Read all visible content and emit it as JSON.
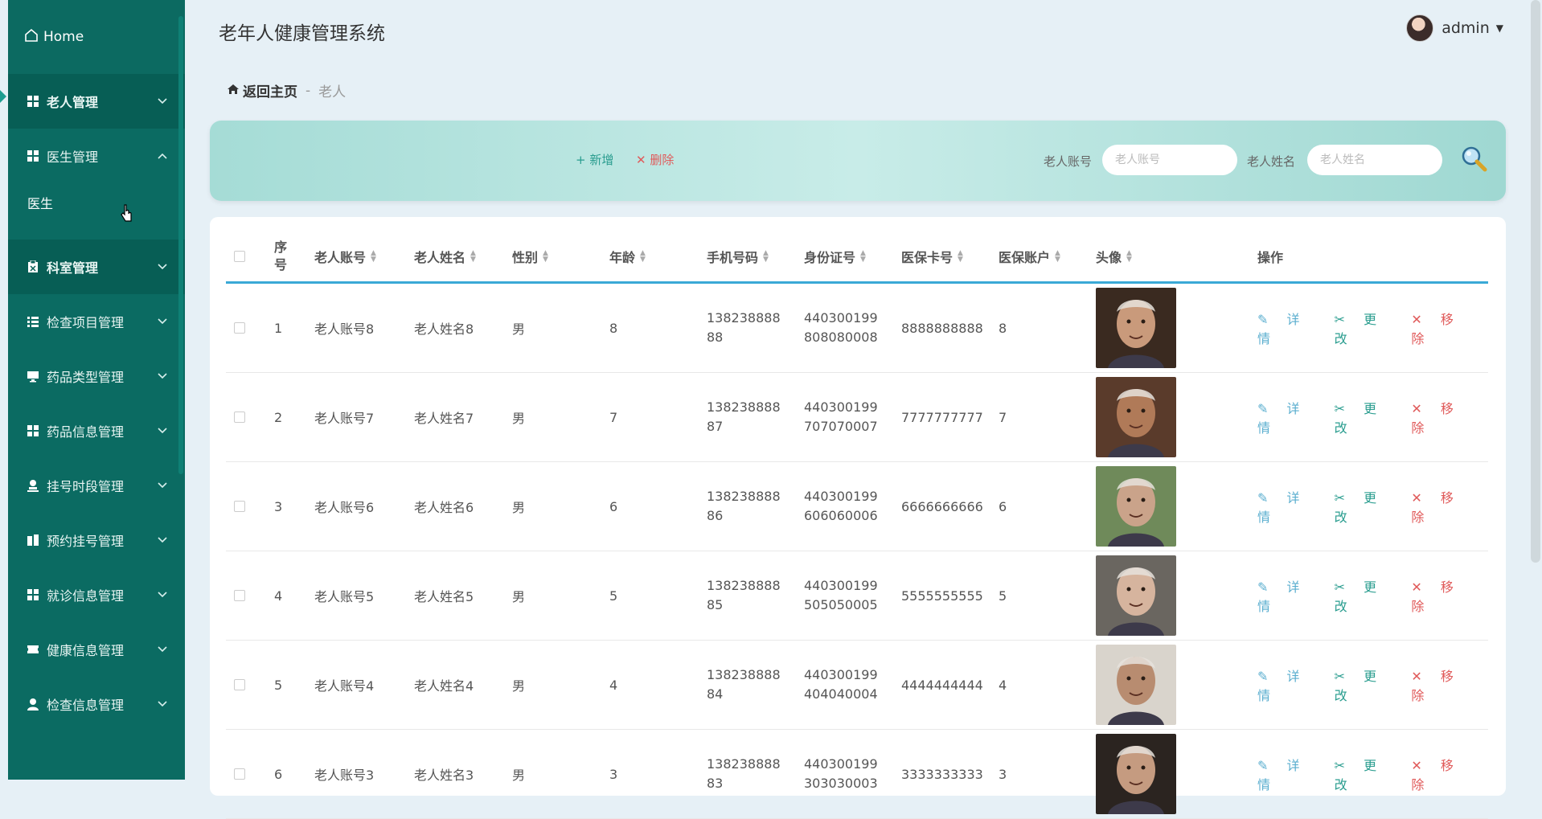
{
  "sidebar": {
    "home": "Home",
    "items": [
      {
        "label": "老人管理",
        "icon": "grid-icon",
        "state": "active"
      },
      {
        "label": "医生管理",
        "icon": "grid-icon",
        "state": "open",
        "children": [
          "医生"
        ]
      },
      {
        "label": "科室管理",
        "icon": "clipboard-icon",
        "state": "dark"
      },
      {
        "label": "检查项目管理",
        "icon": "list-icon",
        "state": ""
      },
      {
        "label": "药品类型管理",
        "icon": "monitor-icon",
        "state": ""
      },
      {
        "label": "药品信息管理",
        "icon": "grid-icon",
        "state": ""
      },
      {
        "label": "挂号时段管理",
        "icon": "user-stamp-icon",
        "state": ""
      },
      {
        "label": "预约挂号管理",
        "icon": "building-icon",
        "state": ""
      },
      {
        "label": "就诊信息管理",
        "icon": "grid-icon",
        "state": ""
      },
      {
        "label": "健康信息管理",
        "icon": "ticket-icon",
        "state": ""
      },
      {
        "label": "检查信息管理",
        "icon": "user-icon",
        "state": ""
      }
    ]
  },
  "header": {
    "title": "老年人健康管理系统",
    "user": "admin"
  },
  "breadcrumb": {
    "home": "返回主页",
    "separator": "-",
    "current": "老人"
  },
  "toolbar": {
    "add": "+ 新增",
    "delete": "✕ 删除",
    "account_label": "老人账号",
    "account_placeholder": "老人账号",
    "name_label": "老人姓名",
    "name_placeholder": "老人姓名"
  },
  "table": {
    "headers": {
      "index": "序号",
      "account": "老人账号",
      "name": "老人姓名",
      "gender": "性别",
      "age": "年龄",
      "phone": "手机号码",
      "id_card": "身份证号",
      "insurance_card": "医保卡号",
      "insurance_account": "医保账户",
      "avatar": "头像",
      "actions": "操作"
    },
    "actions": {
      "detail": "详情",
      "edit": "更改",
      "remove": "移除"
    },
    "rows": [
      {
        "index": "1",
        "account": "老人账号8",
        "name": "老人姓名8",
        "gender": "男",
        "age": "8",
        "phone": "13823888888",
        "id_card": "440300199808080008",
        "insurance_card": "8888888888",
        "insurance_account": "8"
      },
      {
        "index": "2",
        "account": "老人账号7",
        "name": "老人姓名7",
        "gender": "男",
        "age": "7",
        "phone": "13823888887",
        "id_card": "440300199707070007",
        "insurance_card": "7777777777",
        "insurance_account": "7"
      },
      {
        "index": "3",
        "account": "老人账号6",
        "name": "老人姓名6",
        "gender": "男",
        "age": "6",
        "phone": "13823888886",
        "id_card": "440300199606060006",
        "insurance_card": "6666666666",
        "insurance_account": "6"
      },
      {
        "index": "4",
        "account": "老人账号5",
        "name": "老人姓名5",
        "gender": "男",
        "age": "5",
        "phone": "13823888885",
        "id_card": "440300199505050005",
        "insurance_card": "5555555555",
        "insurance_account": "5"
      },
      {
        "index": "5",
        "account": "老人账号4",
        "name": "老人姓名4",
        "gender": "男",
        "age": "4",
        "phone": "13823888884",
        "id_card": "440300199404040004",
        "insurance_card": "4444444444",
        "insurance_account": "4"
      },
      {
        "index": "6",
        "account": "老人账号3",
        "name": "老人姓名3",
        "gender": "男",
        "age": "3",
        "phone": "13823888883",
        "id_card": "440300199303030003",
        "insurance_card": "3333333333",
        "insurance_account": "3"
      }
    ]
  },
  "colors": {
    "sidebar": "#0b6b62",
    "accent": "#3aa9d6",
    "danger": "#e05a5a",
    "teal": "#2a9d8f"
  }
}
